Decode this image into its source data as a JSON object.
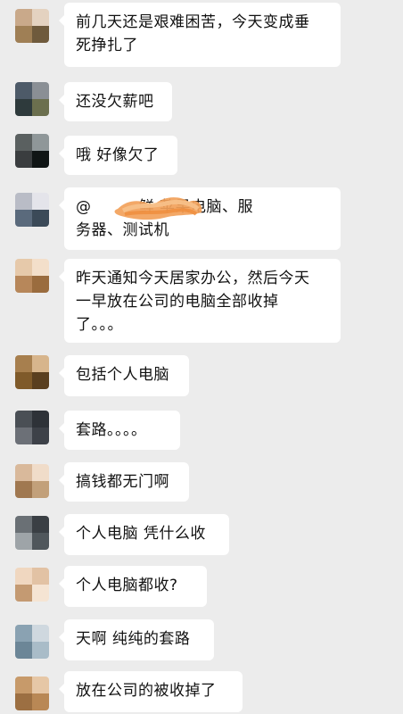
{
  "messages": [
    {
      "text": "前几天还是艰难困苦，今天变成垂\n死挣扎了",
      "avatar": [
        "#c9a98a",
        "#e4d2c0",
        "#9f7f55",
        "#6f5a3c"
      ]
    },
    {
      "text": "还没欠薪吧",
      "avatar": [
        "#4d5a68",
        "#8a8f95",
        "#2e3a3c",
        "#6b6f4e"
      ]
    },
    {
      "text": "哦 好像欠了",
      "avatar": [
        "#5a6060",
        "#8f9799",
        "#3a3d3f",
        "#101515"
      ]
    },
    {
      "text": "@         鲜 苹果电脑、服\n务器、测试机",
      "avatar": [
        "#b9bcc6",
        "#e4e4ea",
        "#5a6a7c",
        "#3b4a58"
      ]
    },
    {
      "text": "昨天通知今天居家办公，然后今天\n一早放在公司的电脑全部收掉\n了。。。",
      "avatar": [
        "#e6c9aa",
        "#f3dfca",
        "#b7875a",
        "#9a6c3e"
      ]
    },
    {
      "text": "包括个人电脑",
      "avatar": [
        "#a77f4e",
        "#d7b58c",
        "#7f5a2a",
        "#5a3f1f"
      ]
    },
    {
      "text": "套路。。。。",
      "avatar": [
        "#4a4f55",
        "#2e3238",
        "#6c7077",
        "#3d4148"
      ]
    },
    {
      "text": "搞钱都无门啊",
      "avatar": [
        "#d9b99b",
        "#f0dcc9",
        "#a07850",
        "#c2a07a"
      ]
    },
    {
      "text": "个人电脑 凭什么收",
      "avatar": [
        "#6a7075",
        "#3a3f44",
        "#9ea4a8",
        "#50575c"
      ]
    },
    {
      "text": "个人电脑都收?",
      "avatar": [
        "#f0d7c0",
        "#e2c2a4",
        "#c49a72",
        "#f5e4d3"
      ]
    },
    {
      "text": "天啊 纯纯的套路",
      "avatar": [
        "#8aa2b2",
        "#cfd8df",
        "#6c8697",
        "#a9bcc8"
      ]
    },
    {
      "text": "放在公司的被收掉了",
      "avatar": [
        "#c79a6a",
        "#e6c7a6",
        "#9c6f42",
        "#b98855"
      ]
    }
  ]
}
